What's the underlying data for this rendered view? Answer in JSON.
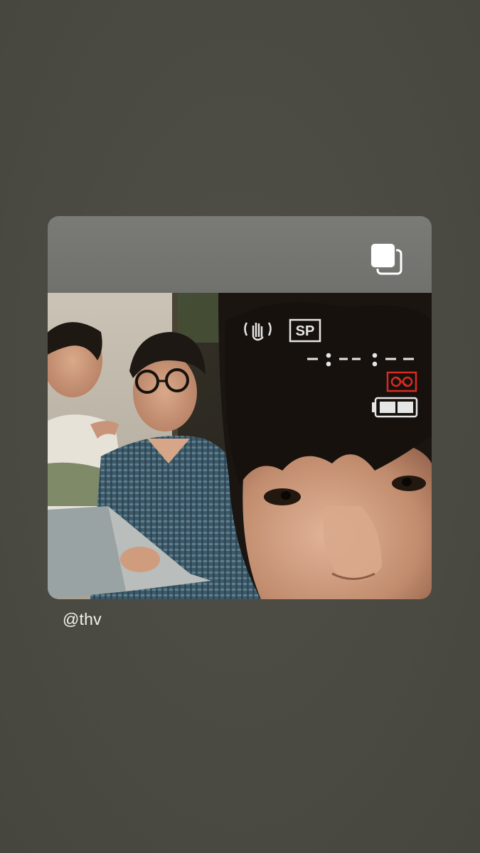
{
  "story": {
    "background_color": "#4b4b43",
    "mention": "@thv"
  },
  "post_card": {
    "header_color": "#727270",
    "multi_photo_indicator": "carousel-icon"
  },
  "camcorder_overlay": {
    "mode_label": "SP",
    "icons": [
      "shake-reduction-icon",
      "tape-icon",
      "battery-icon"
    ],
    "timecode_placeholder": "--:--:--:--"
  }
}
